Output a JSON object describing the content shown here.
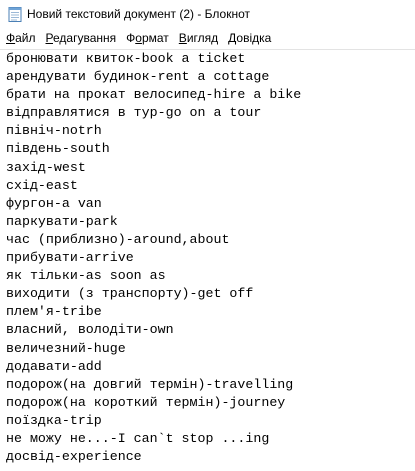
{
  "window": {
    "title": "Новий текстовий документ (2) - Блокнот",
    "icon": "notepad-icon"
  },
  "menu": [
    {
      "accel": "Ф",
      "rest": "айл"
    },
    {
      "accel": "Р",
      "rest": "едагування"
    },
    {
      "accel": "",
      "rest": "Формат",
      "accel_after": "О",
      "label": "Формат"
    },
    {
      "accel": "В",
      "rest": "игляд"
    },
    {
      "accel": "Д",
      "rest": "овідка"
    }
  ],
  "menu_labels": [
    "Файл",
    "Редагування",
    "Формат",
    "Вигляд",
    "Довідка"
  ],
  "editor": {
    "lines": [
      "бронювати квиток-book a ticket",
      "арендувати будинок-rent a cottage",
      "брати на прокат велосипед-hire a bike",
      "відправлятися в тур-go on a tour",
      "північ-notrh",
      "південь-south",
      "захід-west",
      "схід-east",
      "фургон-a van",
      "паркувати-park",
      "час (приблизно)-around,about",
      "прибувати-arrive",
      "як тільки-as soon as",
      "виходити (з транспорту)-get off",
      "плем'я-tribe",
      "власний, володіти-own",
      "величезний-huge",
      "додавати-add",
      "подорож(на довгий термін)-travelling",
      "подорож(на короткий термін)-journey",
      "поїздка-trip",
      "не можу не...-I can`t stop ...ing",
      "досвід-experience"
    ]
  }
}
